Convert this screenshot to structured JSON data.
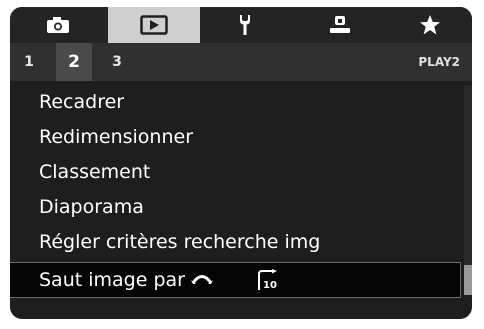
{
  "tabs": [
    {
      "icon": "camera-icon"
    },
    {
      "icon": "play-icon",
      "active": true
    },
    {
      "icon": "wrench-icon"
    },
    {
      "icon": "user-icon"
    },
    {
      "icon": "star-icon"
    }
  ],
  "subtabs": [
    {
      "label": "1"
    },
    {
      "label": "2",
      "active": true
    },
    {
      "label": "3"
    }
  ],
  "page_tag": "PLAY2",
  "menu": {
    "items": [
      {
        "label": "Recadrer"
      },
      {
        "label": "Redimensionner"
      },
      {
        "label": "Classement"
      },
      {
        "label": "Diaporama"
      },
      {
        "label": "Régler critères recherche img"
      },
      {
        "label": "Saut image par",
        "selected": true,
        "value_icon": "jump-10-images-icon",
        "value_text": "10"
      }
    ]
  },
  "colors": {
    "screen_bg": "#1e1e1e",
    "active_tab_bg": "#cfcfcf",
    "subtab_bar_bg": "#303030",
    "text": "#ffffff",
    "selected_row_bg": "#050505"
  }
}
